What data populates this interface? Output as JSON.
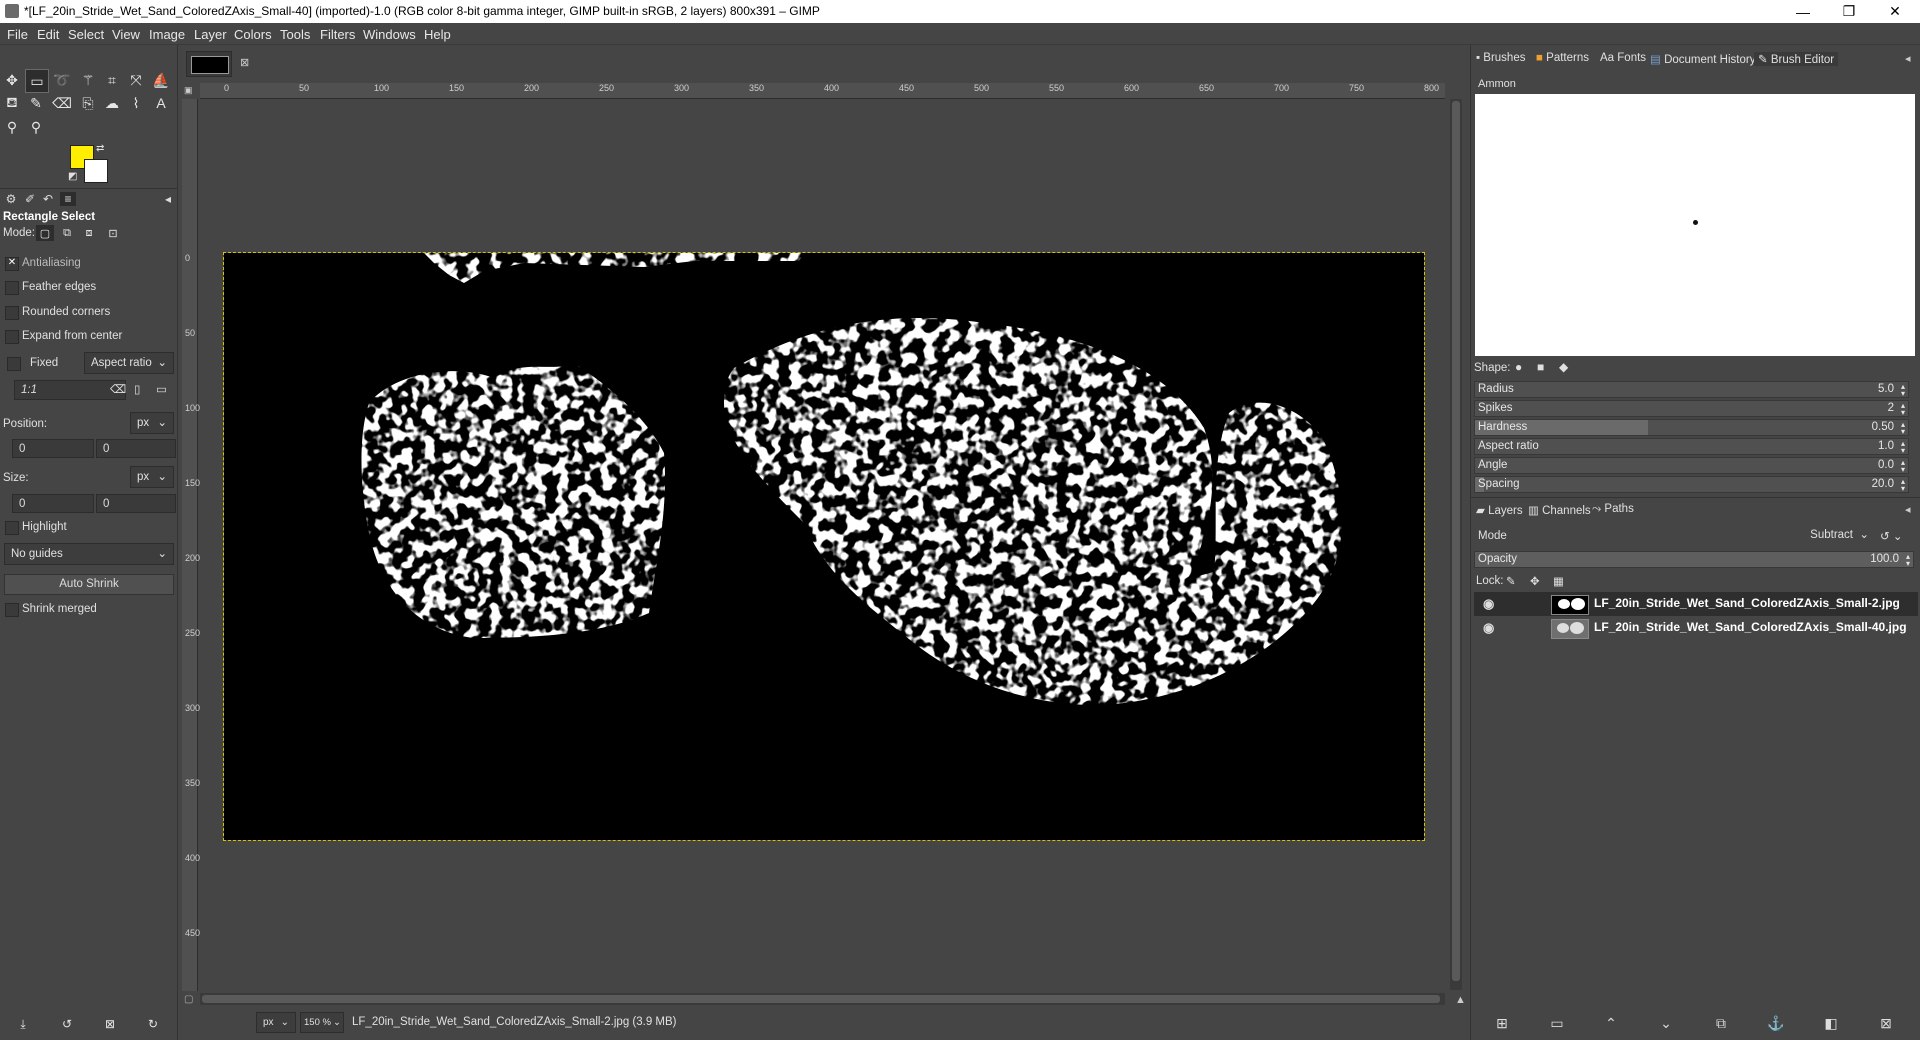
{
  "window": {
    "title": "*[LF_20in_Stride_Wet_Sand_ColoredZAxis_Small-40] (imported)-1.0 (RGB color 8-bit gamma integer, GIMP built-in sRGB, 2 layers) 800x391 – GIMP",
    "controls": [
      "—",
      "❐",
      "✕"
    ]
  },
  "menu": [
    "File",
    "Edit",
    "Select",
    "View",
    "Image",
    "Layer",
    "Colors",
    "Tools",
    "Filters",
    "Windows",
    "Help"
  ],
  "tool_options": {
    "title": "Rectangle Select",
    "mode_label": "Mode:",
    "antialiasing": "Antialiasing",
    "feather": "Feather edges",
    "rounded": "Rounded corners",
    "expand": "Expand from center",
    "fixed": "Fixed",
    "fixed_dropdown": "Aspect ratio",
    "ratio_value": "1:1",
    "position_label": "Position:",
    "position_unit": "px",
    "pos_x": "0",
    "pos_y": "0",
    "size_label": "Size:",
    "size_unit": "px",
    "size_w": "0",
    "size_h": "0",
    "highlight": "Highlight",
    "guides": "No guides",
    "auto_shrink": "Auto Shrink",
    "shrink_merged": "Shrink merged"
  },
  "colors": {
    "foreground": "#ffee00",
    "background": "#ffffff"
  },
  "ruler": {
    "h_ticks": [
      "0",
      "50",
      "100",
      "150",
      "200",
      "250",
      "300",
      "350",
      "400",
      "450",
      "500",
      "550",
      "600",
      "650",
      "700",
      "750",
      "800"
    ],
    "v_ticks": [
      "0",
      "50",
      "100",
      "150",
      "200",
      "250",
      "300",
      "350",
      "400",
      "450"
    ]
  },
  "status": {
    "unit": "px",
    "zoom": "150 %",
    "file": "LF_20in_Stride_Wet_Sand_ColoredZAxis_Small-2.jpg (3.9 MB)"
  },
  "dock_tabs": [
    "Brushes",
    "Patterns",
    "Fonts",
    "Document History",
    "Brush Editor"
  ],
  "brush_editor": {
    "name": "Ammon",
    "shape_label": "Shape:",
    "params": [
      {
        "label": "Radius",
        "value": "5.0",
        "fraction": 0.0
      },
      {
        "label": "Spikes",
        "value": "2",
        "fraction": 0.0
      },
      {
        "label": "Hardness",
        "value": "0.50",
        "fraction": 0.4
      },
      {
        "label": "Aspect ratio",
        "value": "1.0",
        "fraction": 0.0
      },
      {
        "label": "Angle",
        "value": "0.0",
        "fraction": 0.0
      },
      {
        "label": "Spacing",
        "value": "20.0",
        "fraction": 0.02
      }
    ]
  },
  "layers_panel": {
    "tabs": [
      "Layers",
      "Channels",
      "Paths"
    ],
    "mode_label": "Mode",
    "mode_value": "Subtract",
    "opacity_label": "Opacity",
    "opacity_value": "100.0",
    "lock_label": "Lock:",
    "layers": [
      {
        "name": "LF_20in_Stride_Wet_Sand_ColoredZAxis_Small-2.jpg",
        "selected": true
      },
      {
        "name": "LF_20in_Stride_Wet_Sand_ColoredZAxis_Small-40.jpg",
        "selected": false
      }
    ]
  }
}
